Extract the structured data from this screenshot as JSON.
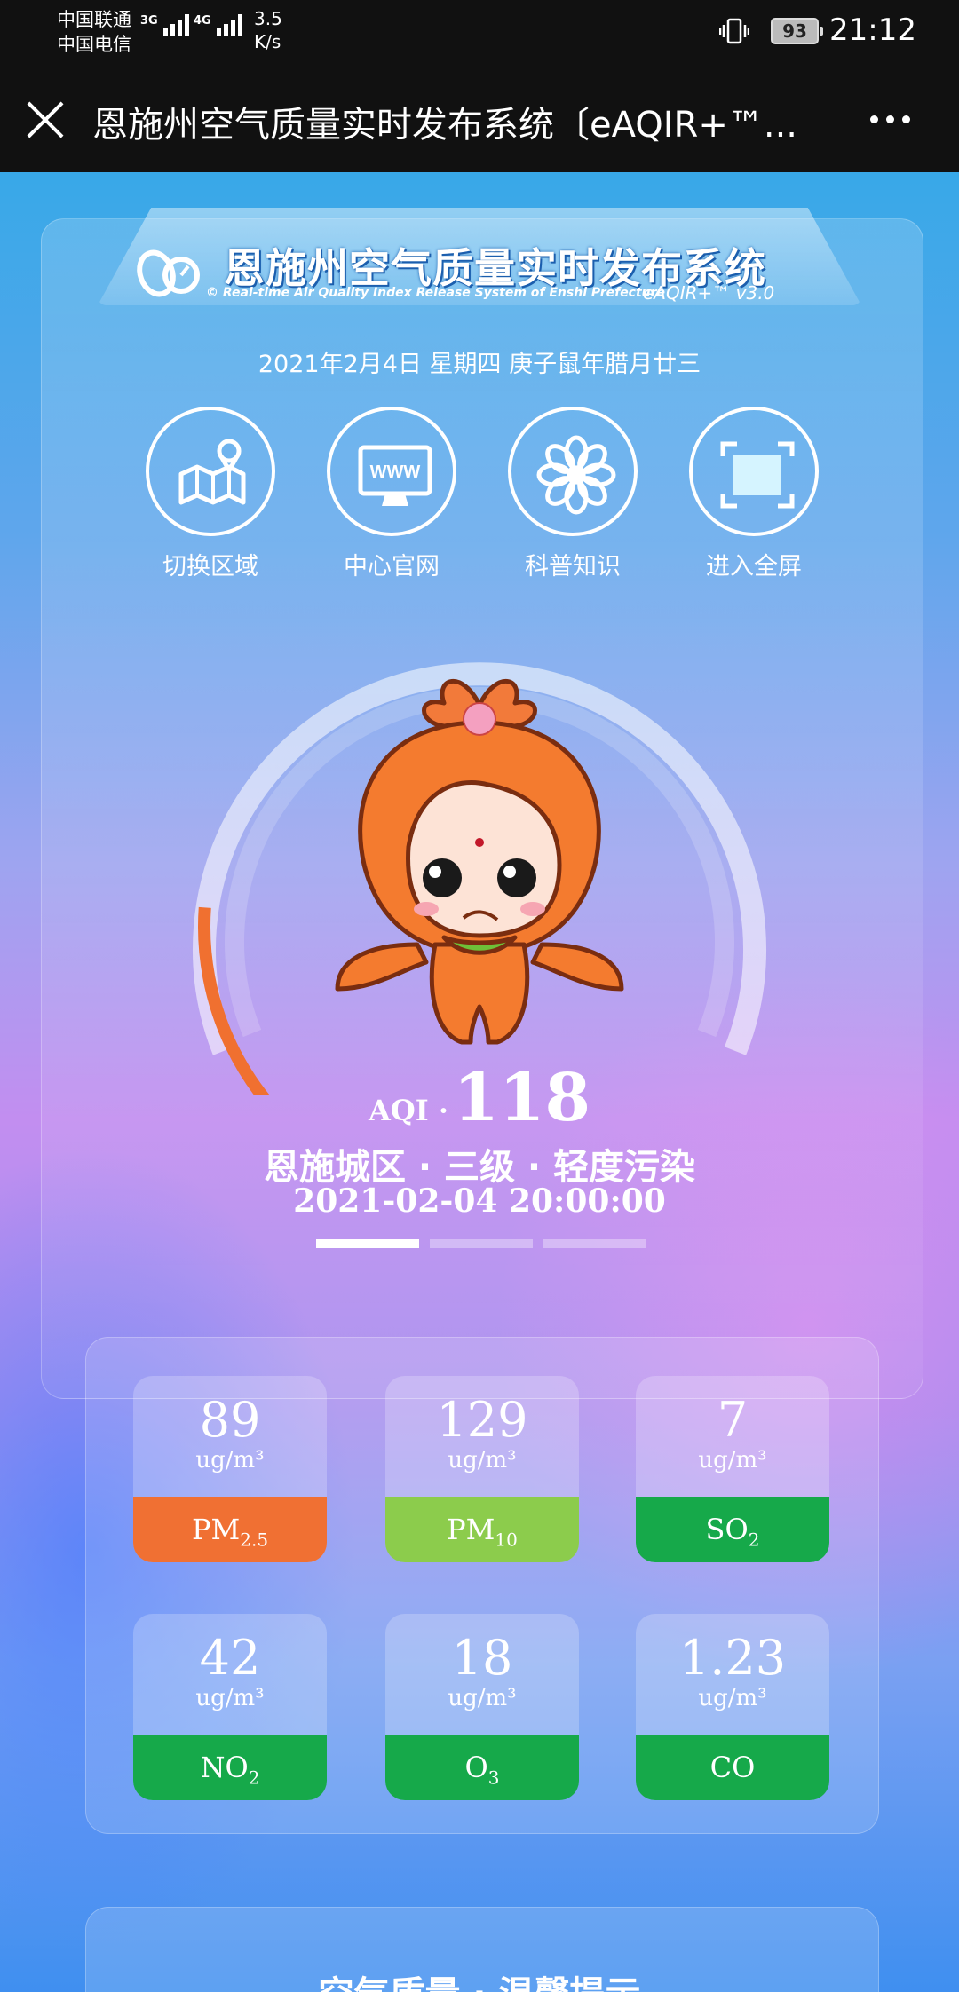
{
  "status_bar": {
    "carrier1": "中国联通",
    "carrier2": "中国电信",
    "net1": "3G",
    "net2": "4G",
    "speed_value": "3.5",
    "speed_unit": "K/s",
    "battery": "93",
    "time": "21:12"
  },
  "title_bar": {
    "title": "恩施州空气质量实时发布系统〔eAQIR+™..."
  },
  "banner": {
    "title": "恩施州空气质量实时发布系统",
    "subtitle": "© Real-time Air Quality Index Release System of Enshi Prefecture",
    "brand": "eAQIR+™ v3.0"
  },
  "date_line": "2021年2月4日  星期四  庚子鼠年腊月廿三",
  "quick_actions": [
    {
      "label": "切换区域",
      "icon": "map-pin-icon"
    },
    {
      "label": "中心官网",
      "icon": "www-monitor-icon"
    },
    {
      "label": "科普知识",
      "icon": "flower-icon"
    },
    {
      "label": "进入全屏",
      "icon": "fullscreen-icon"
    }
  ],
  "aqi": {
    "label": "AQI ·",
    "value": "118",
    "max_scale": 500,
    "gauge_color": "#f07030",
    "station_line": "恩施城区 · 三级 · 轻度污染",
    "timestamp": "2021-02-04 20:00:00"
  },
  "pollutants": [
    {
      "value": "89",
      "unit": "ug/m³",
      "name_main": "PM",
      "name_sub": "2.5",
      "color": "#f07033"
    },
    {
      "value": "129",
      "unit": "ug/m³",
      "name_main": "PM",
      "name_sub": "10",
      "color": "#8ccc4c"
    },
    {
      "value": "7",
      "unit": "ug/m³",
      "name_main": "SO",
      "name_sub": "2",
      "color": "#16a94a"
    },
    {
      "value": "42",
      "unit": "ug/m³",
      "name_main": "NO",
      "name_sub": "2",
      "color": "#16a94a"
    },
    {
      "value": "18",
      "unit": "ug/m³",
      "name_main": "O",
      "name_sub": "3",
      "color": "#16a94a"
    },
    {
      "value": "1.23",
      "unit": "ug/m³",
      "name_main": "CO",
      "name_sub": "",
      "color": "#16a94a"
    }
  ],
  "tips": {
    "title": "空气质量 · 温馨提示"
  }
}
